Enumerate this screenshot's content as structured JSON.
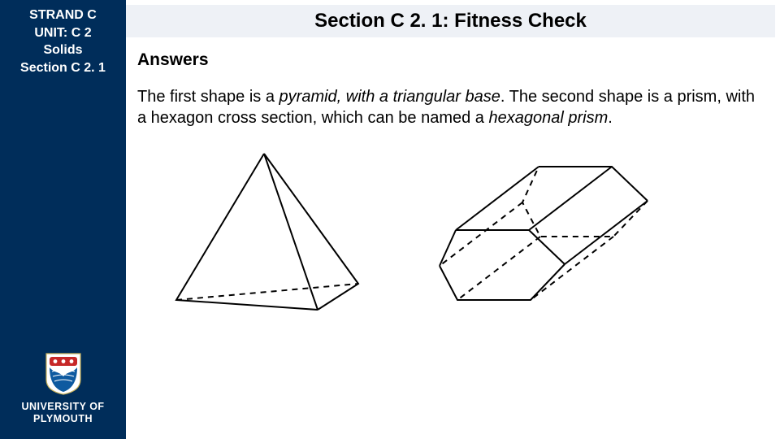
{
  "sidebar": {
    "line1": "STRAND C",
    "line2": "UNIT: C 2",
    "line3": "Solids",
    "line4": "Section C 2. 1",
    "uni_line1": "UNIVERSITY OF",
    "uni_line2": "PLYMOUTH"
  },
  "title": "Section C 2. 1: Fitness Check",
  "answers_heading": "Answers",
  "body": {
    "t1": "The first shape is a ",
    "em1": "pyramid, with a triangular base",
    "t2": ". The second shape is a prism, with a hexagon cross section, which can be named a ",
    "em2": "hexagonal prism",
    "t3": "."
  },
  "figures": {
    "pyramid_alt": "triangular-pyramid",
    "prism_alt": "hexagonal-prism"
  }
}
